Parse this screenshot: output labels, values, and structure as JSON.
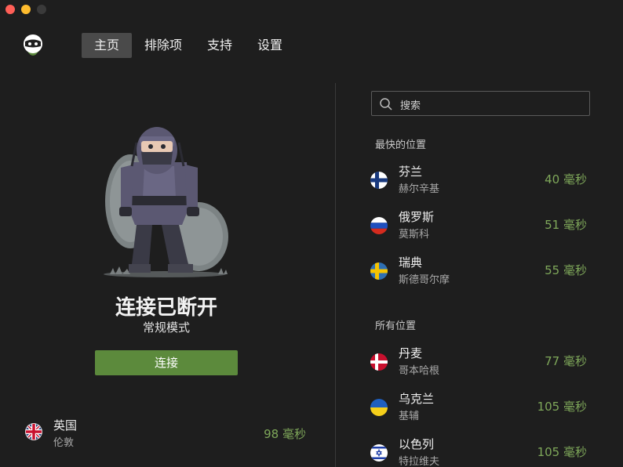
{
  "window": {
    "controls": [
      "close",
      "minimize",
      "maximize"
    ]
  },
  "nav": {
    "items": [
      {
        "label": "主页",
        "active": true
      },
      {
        "label": "排除项",
        "active": false
      },
      {
        "label": "支持",
        "active": false
      },
      {
        "label": "设置",
        "active": false
      }
    ]
  },
  "status": {
    "title": "连接已断开",
    "mode": "常规模式",
    "connect_label": "连接"
  },
  "current_location": {
    "country": "英国",
    "city": "伦敦",
    "latency": "98 毫秒",
    "flag_icon": "uk-flag-icon"
  },
  "search": {
    "placeholder": "搜索"
  },
  "fastest": {
    "label": "最快的位置",
    "items": [
      {
        "country": "芬兰",
        "city": "赫尔辛基",
        "latency": "40 毫秒",
        "flag_icon": "finland-flag-icon"
      },
      {
        "country": "俄罗斯",
        "city": "莫斯科",
        "latency": "51 毫秒",
        "flag_icon": "russia-flag-icon"
      },
      {
        "country": "瑞典",
        "city": "斯德哥尔摩",
        "latency": "55 毫秒",
        "flag_icon": "sweden-flag-icon"
      }
    ]
  },
  "all": {
    "label": "所有位置",
    "items": [
      {
        "country": "丹麦",
        "city": "哥本哈根",
        "latency": "77 毫秒",
        "flag_icon": "denmark-flag-icon"
      },
      {
        "country": "乌克兰",
        "city": "基辅",
        "latency": "105 毫秒",
        "flag_icon": "ukraine-flag-icon"
      },
      {
        "country": "以色列",
        "city": "特拉维夫",
        "latency": "105 毫秒",
        "flag_icon": "israel-flag-icon"
      }
    ]
  },
  "colors": {
    "background": "#1e1e1e",
    "accent_green": "#5c8a3c",
    "latency_green": "#7fa85a",
    "nav_active": "#4a4a4a"
  }
}
